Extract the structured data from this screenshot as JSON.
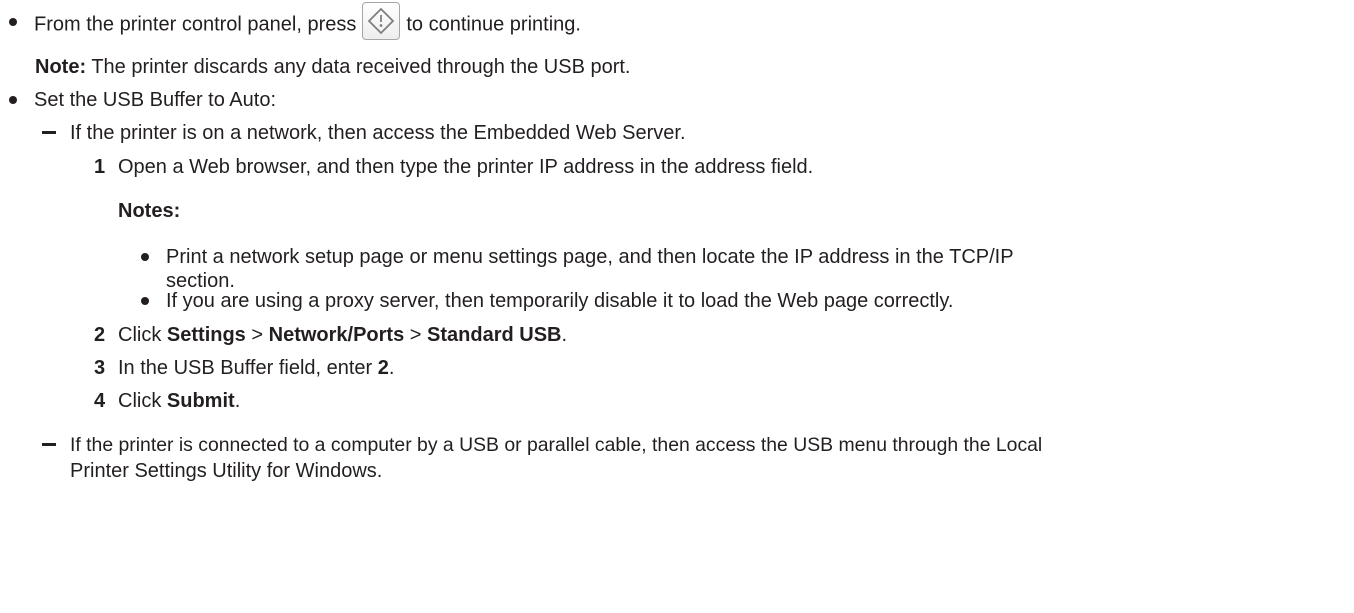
{
  "items": {
    "continue": {
      "pre": "From the printer control panel, press",
      "icon": "start-diamond-icon",
      "post": "to continue printing.",
      "note_label": "Note:",
      "note_text": "The printer discards any data received through the USB port."
    },
    "usb_buffer": {
      "text": "Set the USB Buffer to Auto:",
      "network": {
        "text": "If the printer is on a network, then access the Embedded Web Server.",
        "steps": {
          "s1": {
            "num": "1",
            "text": "Open a Web browser, and then type the printer IP address in the address field.",
            "notes_label": "Notes:",
            "notes": [
              "Print a network setup page or menu settings page, and then locate the IP address in the TCP/IP",
              "section.",
              "If you are using a proxy server, then temporarily disable it to load the Web page correctly."
            ]
          },
          "s2": {
            "num": "2",
            "pre": "Click",
            "settings": "Settings",
            "sep1": ">",
            "network_ports": "Network/Ports",
            "sep2": ">",
            "standard_usb": "Standard USB",
            "end": "."
          },
          "s3": {
            "num": "3",
            "pre": "In the USB Buffer field, enter",
            "value": "2",
            "end": "."
          },
          "s4": {
            "num": "4",
            "pre": "Click",
            "submit": "Submit",
            "end": "."
          }
        }
      },
      "usb": {
        "line1": "If the printer is connected to a computer by a USB or parallel cable, then access the USB menu through the Local",
        "line2": "Printer Settings Utility for Windows."
      }
    }
  }
}
